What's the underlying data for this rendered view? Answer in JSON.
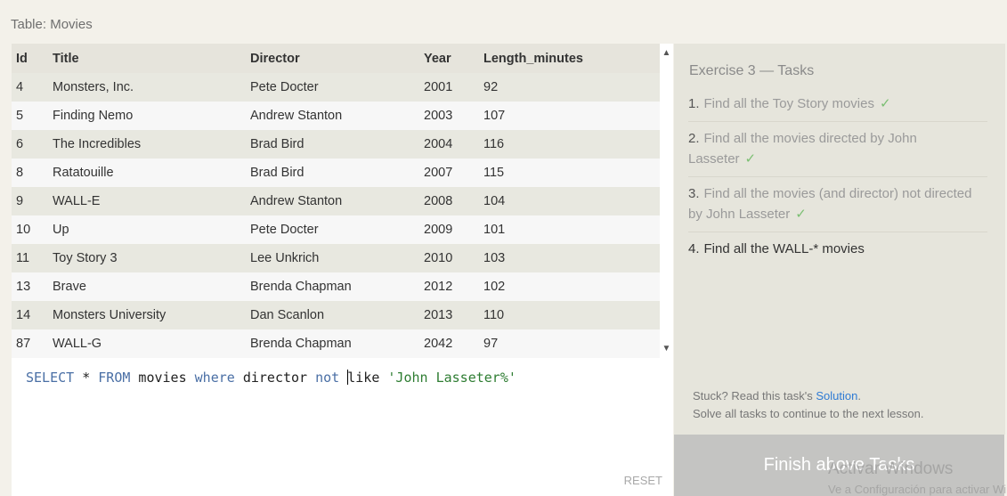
{
  "table_label": "Table: Movies",
  "results": {
    "columns": [
      "Id",
      "Title",
      "Director",
      "Year",
      "Length_minutes"
    ],
    "rows": [
      [
        "4",
        "Monsters, Inc.",
        "Pete Docter",
        "2001",
        "92"
      ],
      [
        "5",
        "Finding Nemo",
        "Andrew Stanton",
        "2003",
        "107"
      ],
      [
        "6",
        "The Incredibles",
        "Brad Bird",
        "2004",
        "116"
      ],
      [
        "8",
        "Ratatouille",
        "Brad Bird",
        "2007",
        "115"
      ],
      [
        "9",
        "WALL-E",
        "Andrew Stanton",
        "2008",
        "104"
      ],
      [
        "10",
        "Up",
        "Pete Docter",
        "2009",
        "101"
      ],
      [
        "11",
        "Toy Story 3",
        "Lee Unkrich",
        "2010",
        "103"
      ],
      [
        "13",
        "Brave",
        "Brenda Chapman",
        "2012",
        "102"
      ],
      [
        "14",
        "Monsters University",
        "Dan Scanlon",
        "2013",
        "110"
      ],
      [
        "87",
        "WALL-G",
        "Brenda Chapman",
        "2042",
        "97"
      ]
    ],
    "scroll_up_icon": "triangle-up-icon",
    "scroll_down_icon": "triangle-down-icon"
  },
  "editor": {
    "query": {
      "t1": "SELECT",
      "t2": " * ",
      "t3": "FROM",
      "t4": " movies ",
      "t5": "where",
      "t6": " director ",
      "t7": "not",
      "t8": " ",
      "t9": "like",
      "t10": " ",
      "t11": "'John Lasseter%'"
    },
    "reset_label": "RESET"
  },
  "tasks": {
    "title": "Exercise 3 — Tasks",
    "items": [
      {
        "number": "1.",
        "text": "Find all the Toy Story movies",
        "completed": true
      },
      {
        "number": "2.",
        "text": "Find all the movies directed by John Lasseter",
        "completed": true
      },
      {
        "number": "3.",
        "text": "Find all the movies (and director) not directed by John Lasseter",
        "completed": true
      },
      {
        "number": "4.",
        "text": "Find all the WALL-* movies",
        "completed": false
      }
    ],
    "check_mark": "✓",
    "stuck_prefix": "Stuck? Read this task's ",
    "solution_link": "Solution",
    "stuck_suffix": ".",
    "continue_text": "Solve all tasks to continue to the next lesson."
  },
  "finish_button": "Finish above Tasks",
  "watermark": {
    "line1": "Activar Windows",
    "line2": "Ve a Configuración para activar Windows."
  },
  "colors": {
    "keyword": "#4a6fa5",
    "string": "#2e7d32",
    "check": "#7bbf72",
    "link": "#2f7bd4",
    "finish_bg": "#c4c4c2"
  }
}
